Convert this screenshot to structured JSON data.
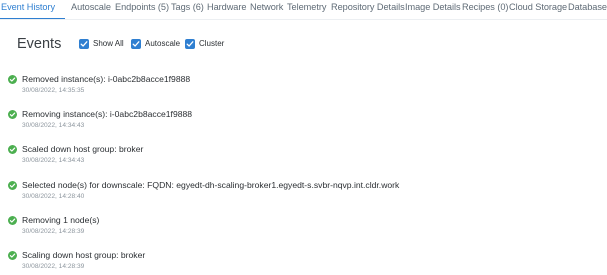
{
  "tabs": [
    {
      "label": "Event History",
      "active": true
    },
    {
      "label": "Autoscale"
    },
    {
      "label": "Endpoints (5)"
    },
    {
      "label": "Tags (6)"
    },
    {
      "label": "Hardware"
    },
    {
      "label": "Network"
    },
    {
      "label": "Telemetry"
    },
    {
      "label": "Repository Details"
    },
    {
      "label": "Image Details"
    },
    {
      "label": "Recipes (0)"
    },
    {
      "label": "Cloud Storage"
    },
    {
      "label": "Database"
    }
  ],
  "events_section": {
    "title": "Events",
    "filters": [
      {
        "label": "Show All",
        "checked": true
      },
      {
        "label": "Autoscale",
        "checked": true
      },
      {
        "label": "Cluster",
        "checked": true
      }
    ]
  },
  "events": [
    {
      "message": "Removed instance(s): i-0abc2b8acce1f9888",
      "time": "30/08/2022, 14:35:35",
      "status": "success"
    },
    {
      "message": "Removing instance(s): i-0abc2b8acce1f9888",
      "time": "30/08/2022, 14:34:43",
      "status": "success"
    },
    {
      "message": "Scaled down host group: broker",
      "time": "30/08/2022, 14:34:43",
      "status": "success"
    },
    {
      "message": "Selected node(s) for downscale: FQDN: egyedt-dh-scaling-broker1.egyedt-s.svbr-nqvp.int.cldr.work",
      "time": "30/08/2022, 14:28:40",
      "status": "success"
    },
    {
      "message": "Removing 1 node(s)",
      "time": "30/08/2022, 14:28:39",
      "status": "success"
    },
    {
      "message": "Scaling down host group: broker",
      "time": "30/08/2022, 14:28:39",
      "status": "success"
    }
  ],
  "colors": {
    "accent": "#2f7fd1",
    "success": "#4caf50",
    "tab_text": "#5f6b76",
    "timestamp": "#8d969e"
  }
}
